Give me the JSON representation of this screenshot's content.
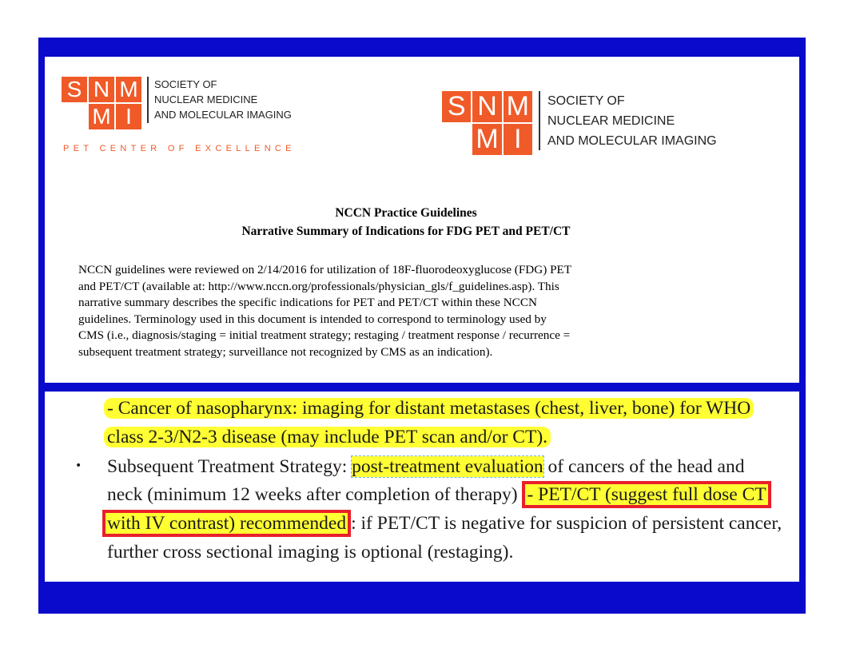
{
  "logos": {
    "small": {
      "letters": [
        "S",
        "N",
        "M",
        "M",
        "I"
      ],
      "lines": [
        "SOCIETY OF",
        "NUCLEAR MEDICINE",
        "AND MOLECULAR IMAGING"
      ],
      "tagline": "PET CENTER OF EXCELLENCE"
    },
    "large": {
      "letters": [
        "S",
        "N",
        "M",
        "M",
        "I"
      ],
      "lines": [
        "SOCIETY OF",
        "NUCLEAR MEDICINE",
        "AND MOLECULAR IMAGING"
      ]
    },
    "brand_color": "#f05a28"
  },
  "document": {
    "title": "NCCN Practice Guidelines",
    "subtitle": "Narrative Summary of Indications for FDG PET and PET/CT",
    "paragraph_lines": [
      "NCCN guidelines were reviewed on 2/14/2016 for utilization of 18F-fluorodeoxyglucose (FDG) PET",
      "and PET/CT (available at: http://www.nccn.org/professionals/physician_gls/f_guidelines.asp). This",
      "narrative summary describes the specific indications for PET and PET/CT within these NCCN",
      "guidelines. Terminology used in this document is intended to correspond to terminology used by",
      "CMS (i.e., diagnosis/staging = initial treatment strategy; restaging / treatment response / recurrence =",
      "subsequent treatment strategy; surveillance not recognized by CMS as an indication)."
    ]
  },
  "excerpt": {
    "line1": "- Cancer of nasopharynx: imaging for distant metastases (chest, liver, bone) for WHO",
    "line2": "class 2-3/N2-3 disease (may include PET scan and/or CT).",
    "line3_a": "Subsequent Treatment Strategy: ",
    "line3_b": "post-treatment evaluation",
    "line3_c": " of cancers of the head and",
    "line4_a": "neck (minimum 12 weeks after completion of therapy) ",
    "line4_b": "- PET/CT (suggest full dose CT",
    "line5_a": "with IV contrast) recommended",
    "line5_b": ": if PET/CT is negative for suspicion of persistent cancer,",
    "line6": "further cross sectional imaging is optional (restaging).",
    "bullet": "•"
  },
  "colors": {
    "frame": "#0a0acc",
    "highlight": "#ffff33",
    "red_box": "#e8202a"
  }
}
